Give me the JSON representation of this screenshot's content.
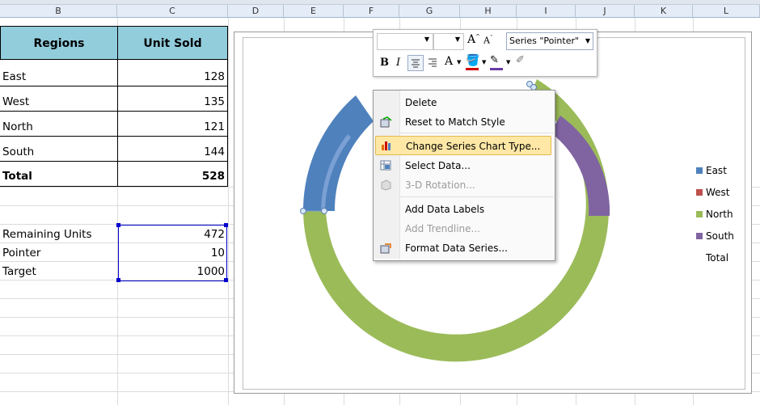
{
  "columns": [
    "B",
    "C",
    "D",
    "E",
    "F",
    "G",
    "H",
    "I",
    "J",
    "K",
    "L"
  ],
  "table": {
    "header": [
      "Regions",
      "Unit Sold"
    ],
    "rows": [
      {
        "region": "East",
        "value": "128"
      },
      {
        "region": "West",
        "value": "135"
      },
      {
        "region": "North",
        "value": "121"
      },
      {
        "region": "South",
        "value": "144"
      }
    ],
    "total": {
      "label": "Total",
      "value": "528"
    }
  },
  "params": [
    {
      "label": "Remaining Units",
      "value": "472"
    },
    {
      "label": "Pointer",
      "value": "10"
    },
    {
      "label": "Target",
      "value": "1000"
    }
  ],
  "legend": [
    {
      "name": "East",
      "color": "#4f81bd"
    },
    {
      "name": "West",
      "color": "#c0504d"
    },
    {
      "name": "North",
      "color": "#9bbb59"
    },
    {
      "name": "South",
      "color": "#8064a2"
    },
    {
      "name": "Total",
      "color": ""
    }
  ],
  "mini_toolbar": {
    "series_select": "Series \"Pointer\"",
    "bold": "B",
    "italic": "I",
    "font_color_glyph": "A"
  },
  "context_menu": [
    {
      "label": "Delete",
      "icon": "none",
      "enabled": true
    },
    {
      "label": "Reset to Match Style",
      "icon": "reset-style-icon",
      "enabled": true
    },
    {
      "label": "Change Series Chart Type...",
      "icon": "chart-type-icon",
      "enabled": true,
      "highlighted": true
    },
    {
      "label": "Select Data...",
      "icon": "select-data-icon",
      "enabled": true
    },
    {
      "label": "3-D Rotation...",
      "icon": "3d-rotation-icon",
      "enabled": false
    },
    {
      "label": "Add Data Labels",
      "icon": "none",
      "enabled": true
    },
    {
      "label": "Add Trendline...",
      "icon": "none",
      "enabled": false
    },
    {
      "label": "Format Data Series...",
      "icon": "format-series-icon",
      "enabled": true
    }
  ],
  "colors": {
    "header_fill": "#92cddc",
    "accent": "#4f81bd",
    "menu_highlight": "#ffe8a6"
  }
}
